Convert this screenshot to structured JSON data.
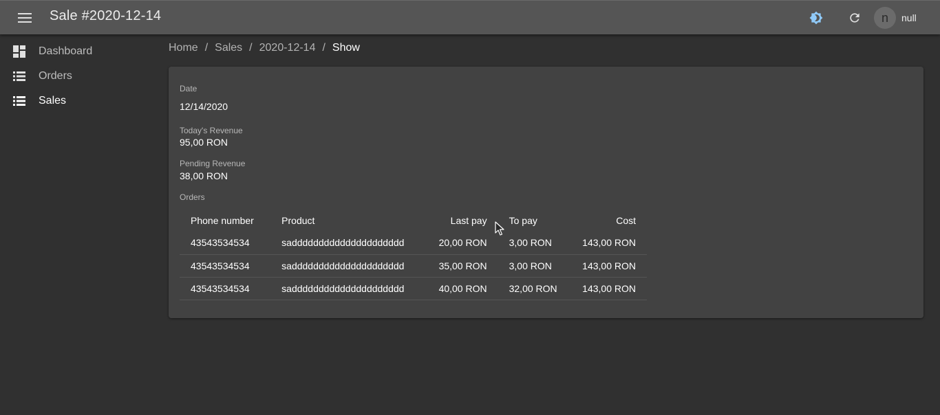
{
  "appbar": {
    "title": "Sale #2020-12-14",
    "menu_icon": "menu-icon",
    "theme_icon": "theme-toggle-icon",
    "refresh_icon": "refresh-icon",
    "theme_icon_color": "#90caf9",
    "user": {
      "avatar_letter": "n",
      "name": "null"
    }
  },
  "sidebar": {
    "items": [
      {
        "label": "Dashboard",
        "icon": "dashboard-icon"
      },
      {
        "label": "Orders",
        "icon": "list-icon"
      },
      {
        "label": "Sales",
        "icon": "list-icon",
        "active": true
      }
    ]
  },
  "breadcrumb": {
    "items": [
      "Home",
      "Sales",
      "2020-12-14",
      "Show"
    ],
    "separator": "/"
  },
  "sale": {
    "date_label": "Date",
    "date_value": "12/14/2020",
    "todays_revenue_label": "Today's Revenue",
    "todays_revenue_value": "95,00 RON",
    "pending_revenue_label": "Pending Revenue",
    "pending_revenue_value": "38,00 RON",
    "orders_label": "Orders"
  },
  "orders_table": {
    "headers": [
      "Phone number",
      "Product",
      "Last pay",
      "To pay",
      "Cost"
    ],
    "rows": [
      [
        "43543534534",
        "saddddddddddddddddddddd",
        "20,00 RON",
        "3,00 RON",
        "143,00 RON"
      ],
      [
        "43543534534",
        "saddddddddddddddddddddd",
        "35,00 RON",
        "3,00 RON",
        "143,00 RON"
      ],
      [
        "43543534534",
        "saddddddddddddddddddddd",
        "40,00 RON",
        "32,00 RON",
        "143,00 RON"
      ]
    ]
  },
  "colors": {
    "background": "#303030",
    "appbar": "#555555",
    "card": "#424242"
  }
}
